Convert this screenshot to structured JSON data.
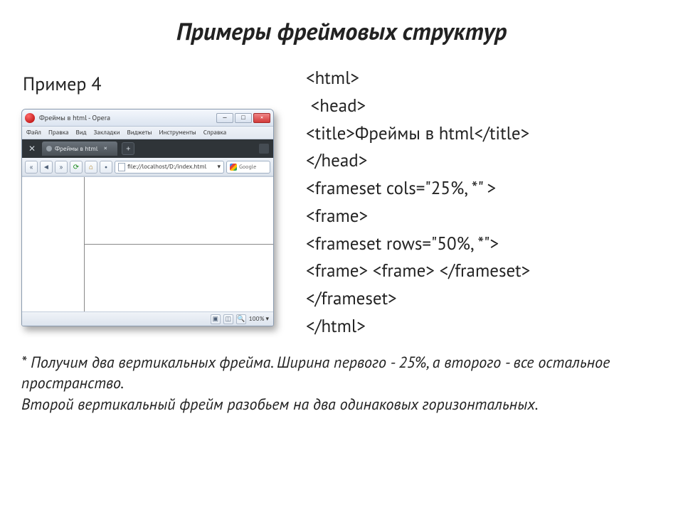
{
  "slide": {
    "title": "Примеры фреймовых структур",
    "subtitle": "Пример 4"
  },
  "browser": {
    "window_title": "Фреймы в html - Opera",
    "win_min": "—",
    "win_max": "□",
    "win_close": "×",
    "menu": [
      "Файл",
      "Правка",
      "Вид",
      "Закладки",
      "Виджеты",
      "Инструменты",
      "Справка"
    ],
    "tab_label": "Фреймы в html",
    "tab_close": "×",
    "tab_add": "+",
    "nav": {
      "back": "◄",
      "back2": "«",
      "fwd": "»",
      "reload": "⟳",
      "home": "⌂",
      "bullet": "•",
      "drop": "▾"
    },
    "url": "file://localhost/D:/index.html",
    "search_placeholder": "Google",
    "zoom_label": "100%",
    "status": {
      "cam": "▣",
      "view": "◫",
      "zoom": "🔍"
    }
  },
  "code": {
    "l1": "<html>",
    "l2": " <head>",
    "l3": "<title>Фреймы в html</title>",
    "l4": "</head>",
    "l5": "<frameset cols=\"25%, *\" >",
    "l6": "<frame>",
    "l7": "<frameset rows=\"50%, *\">",
    "l8": "<frame> <frame> </frameset>",
    "l9": "</frameset>",
    "l10": "</html>"
  },
  "footer": {
    "p1": "* Получим два вертикальных фрейма. Ширина первого - 25%, а второго - все остальное пространство.",
    "p2": "Второй вертикальный фрейм разобьем на два одинаковых горизонтальных."
  }
}
